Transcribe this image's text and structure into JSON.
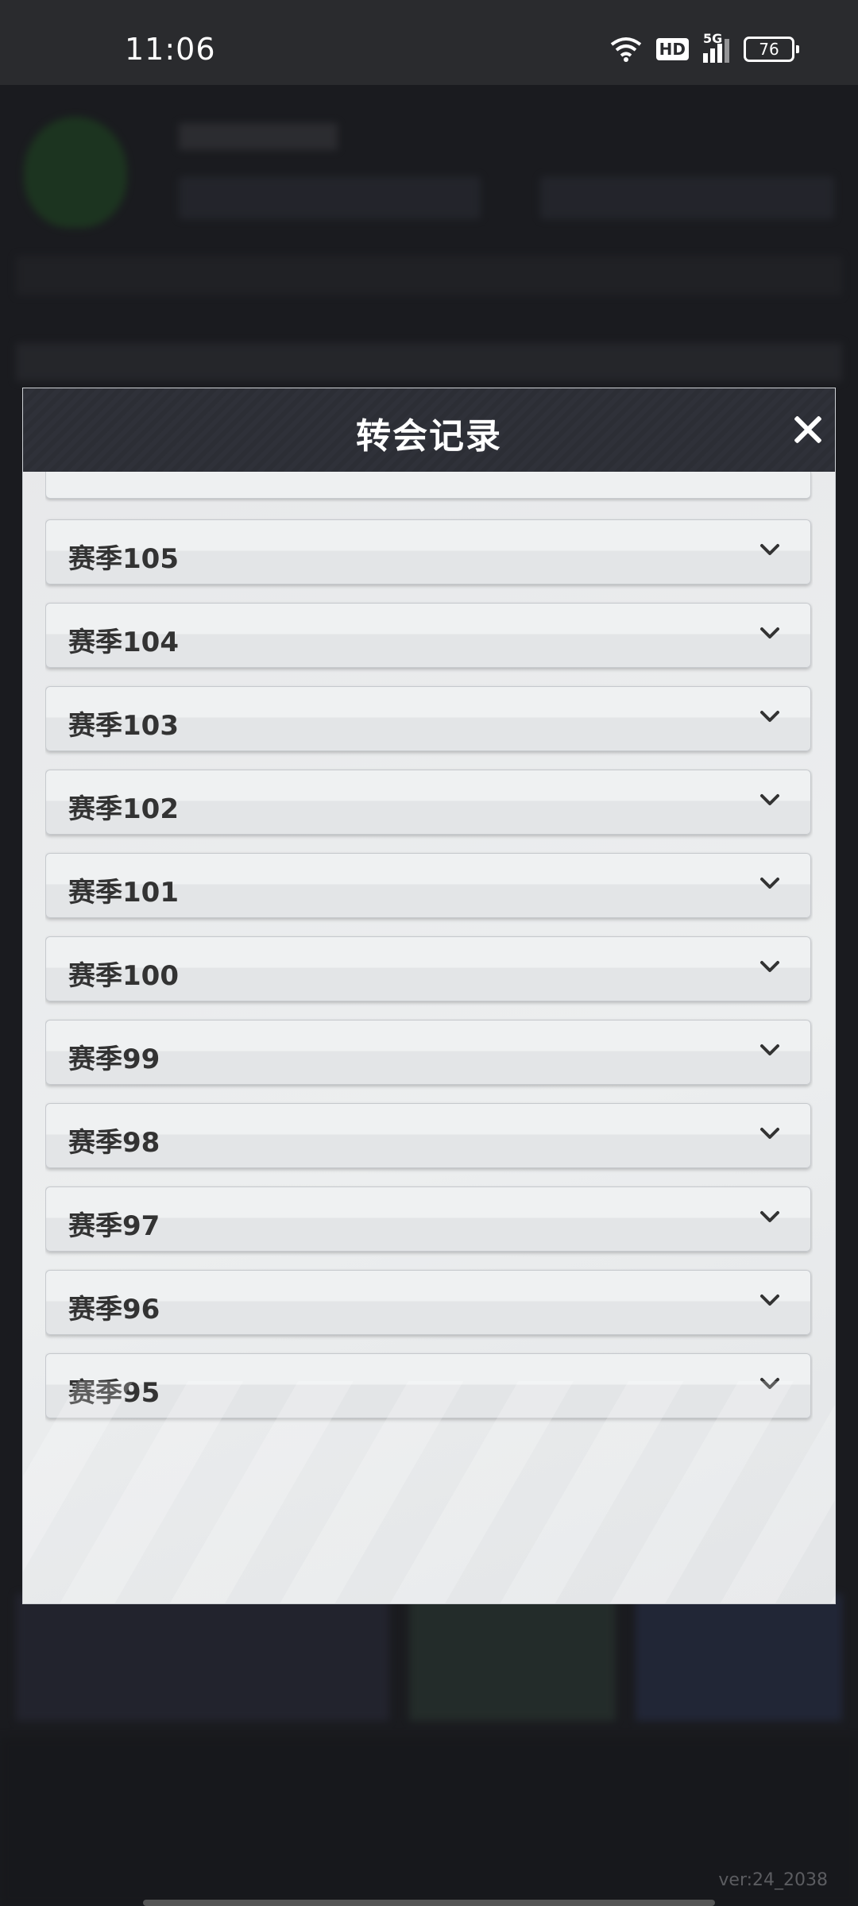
{
  "status_bar": {
    "time": "11:06",
    "network_label": "HD",
    "signal_label": "5G",
    "battery": "76"
  },
  "modal": {
    "title": "转会记录",
    "close_icon": "close-icon",
    "items": [
      {
        "label": "赛季105"
      },
      {
        "label": "赛季104"
      },
      {
        "label": "赛季103"
      },
      {
        "label": "赛季102"
      },
      {
        "label": "赛季101"
      },
      {
        "label": "赛季100"
      },
      {
        "label": "赛季99"
      },
      {
        "label": "赛季98"
      },
      {
        "label": "赛季97"
      },
      {
        "label": "赛季96"
      },
      {
        "label": "赛季95"
      }
    ]
  },
  "footer": {
    "version": "ver:24_2038"
  }
}
